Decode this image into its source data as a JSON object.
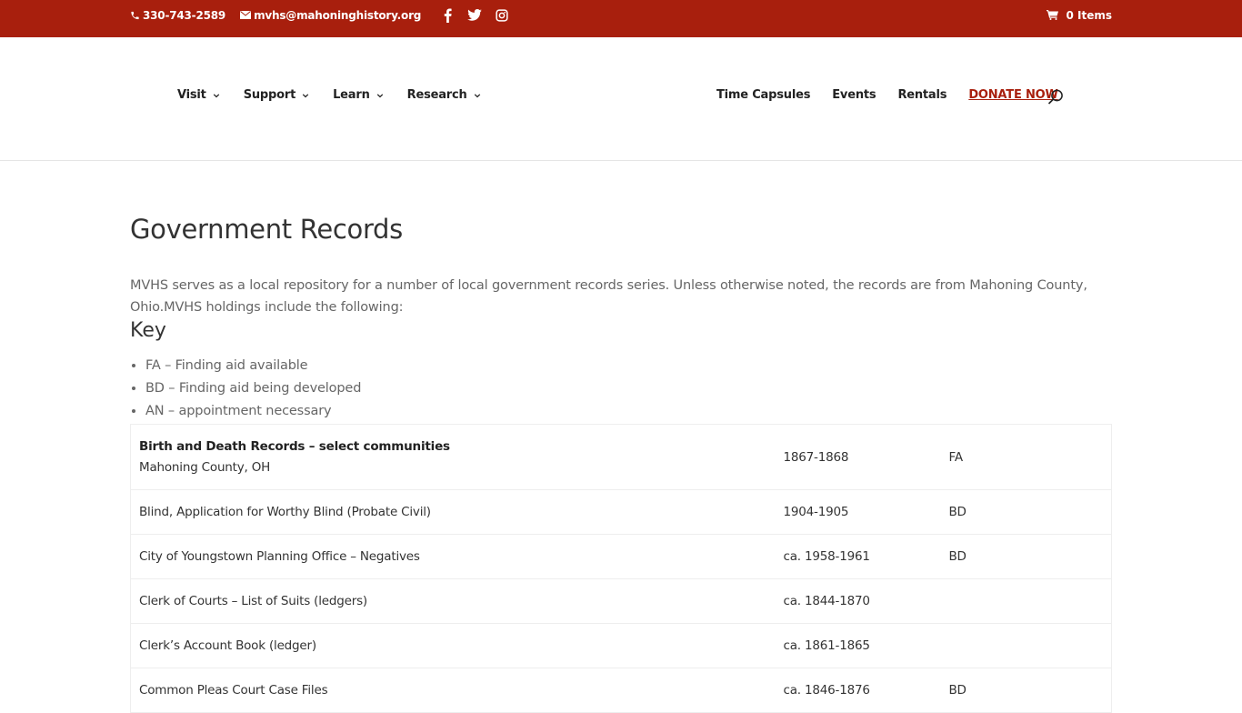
{
  "topbar": {
    "phone": "330-743-2589",
    "email": "mvhs@mahoninghistory.org",
    "social": [
      "facebook-icon",
      "twitter-icon",
      "instagram-icon"
    ],
    "cart_label": "0 Items",
    "bg_color": "#a81f0d"
  },
  "nav": {
    "left": [
      {
        "label": "Visit"
      },
      {
        "label": "Support"
      },
      {
        "label": "Learn"
      },
      {
        "label": "Research"
      }
    ],
    "right": [
      {
        "label": "Time Capsules"
      },
      {
        "label": "Events"
      },
      {
        "label": "Rentals"
      }
    ],
    "donate_label": "DONATE NOW",
    "donate_color": "#a81f0d"
  },
  "main": {
    "title": "Government Records",
    "intro": "MVHS serves as a local repository for a number of local government records series. Unless otherwise noted, the records are from Mahoning County, Ohio.MVHS holdings include the following:",
    "key_title": "Key",
    "key_items": [
      "FA – Finding aid available",
      "BD – Finding aid being developed",
      "AN – appointment necessary"
    ],
    "records": [
      {
        "title": "Birth and Death Records – select communities",
        "subtitle": "Mahoning County, OH",
        "dates": "1867-1868",
        "code": "FA"
      },
      {
        "title": "Blind, Application for Worthy Blind (Probate Civil)",
        "dates": "1904-1905",
        "code": "BD"
      },
      {
        "title": "City of Youngstown Planning Office – Negatives",
        "dates": "ca. 1958-1961",
        "code": "BD"
      },
      {
        "title": "Clerk of Courts – List of Suits (ledgers)",
        "dates": "ca. 1844-1870",
        "code": ""
      },
      {
        "title": "Clerk’s Account Book (ledger)",
        "dates": "ca. 1861-1865",
        "code": ""
      },
      {
        "title": "Common Pleas Court Case Files",
        "dates": "ca. 1846-1876",
        "code": "BD"
      }
    ]
  }
}
